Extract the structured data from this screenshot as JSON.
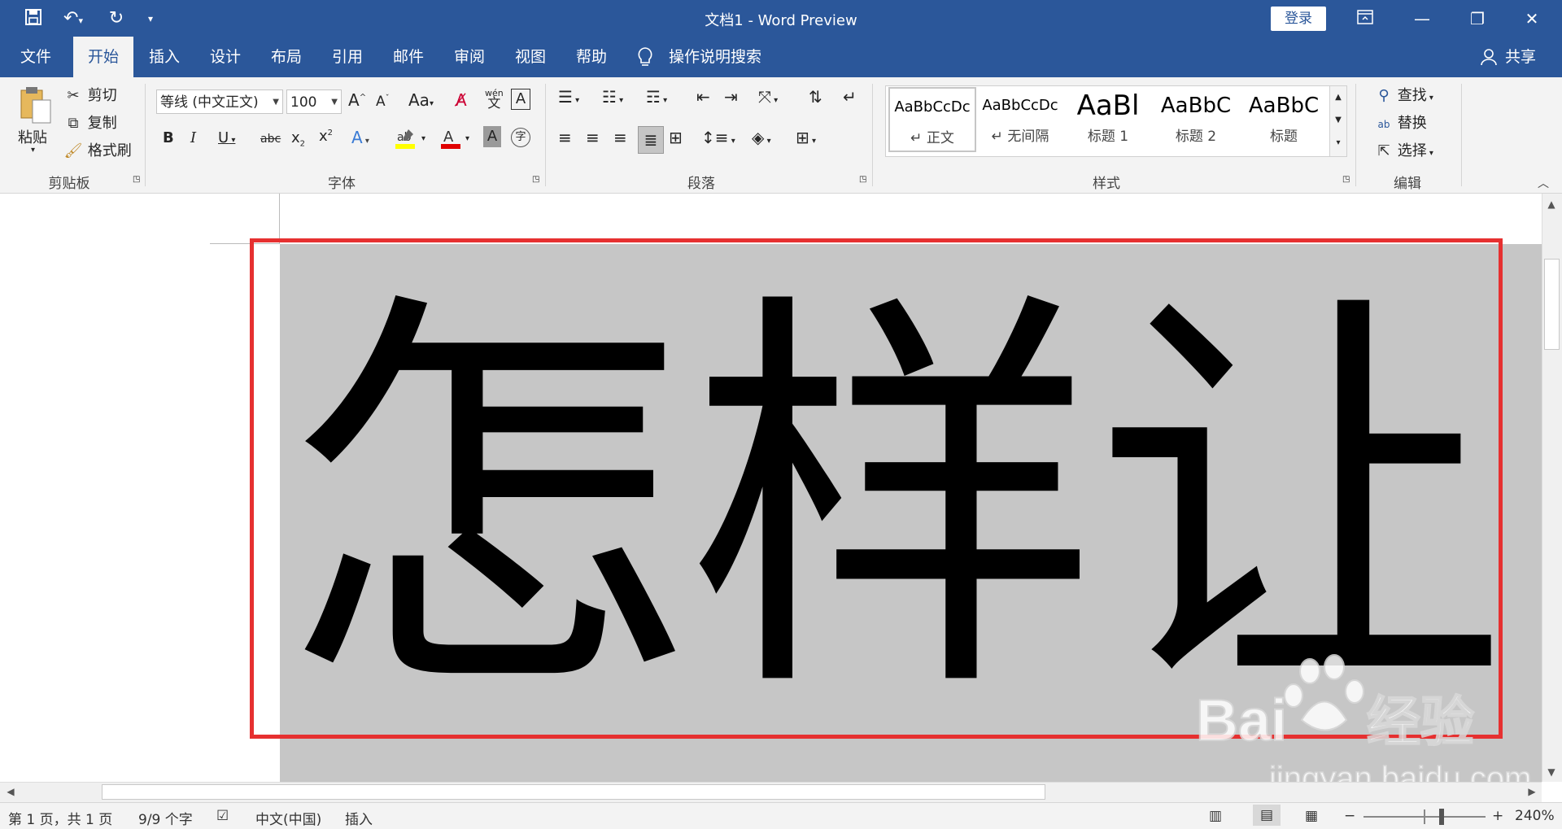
{
  "titlebar": {
    "doc_title": "文档1  -  Word Preview",
    "login": "登录",
    "icons": [
      "save-icon",
      "undo-icon",
      "redo-icon",
      "customize-qat-icon",
      "ribbon-display-icon",
      "restore-icon",
      "close-icon"
    ]
  },
  "tabs": [
    "文件",
    "开始",
    "插入",
    "设计",
    "布局",
    "引用",
    "邮件",
    "审阅",
    "视图",
    "帮助"
  ],
  "active_tab": "开始",
  "tell_me": "操作说明搜索",
  "share": "共享",
  "clipboard": {
    "paste": "粘贴",
    "cut": "剪切",
    "copy": "复制",
    "format_painter": "格式刷",
    "label": "剪贴板"
  },
  "font": {
    "name": "等线 (中文正文)",
    "size": "100",
    "label": "字体",
    "change_case": "Aa",
    "phonetic": "wén"
  },
  "paragraph": {
    "label": "段落"
  },
  "styles": {
    "label": "样式",
    "items": [
      {
        "preview": "AaBbCcDc",
        "name": "↵ 正文"
      },
      {
        "preview": "AaBbCcDc",
        "name": "↵ 无间隔"
      },
      {
        "preview": "AaBl",
        "name": "标题 1"
      },
      {
        "preview": "AaBbC",
        "name": "标题 2"
      },
      {
        "preview": "AaBbC",
        "name": "标题"
      }
    ]
  },
  "editing": {
    "find": "查找",
    "replace": "替换",
    "select": "选择",
    "label": "编辑"
  },
  "document": {
    "text": "怎样让"
  },
  "status": {
    "page": "第 1 页，共 1 页",
    "words": "9/9 个字",
    "language": "中文(中国)",
    "mode": "插入",
    "zoom": "240%"
  },
  "watermark": {
    "brand": "Bai",
    "brand2": "经验",
    "url": "jingyan.baidu.com"
  },
  "colors": {
    "accent": "#2b579a",
    "highlight": "#c6c6c6",
    "box": "#e63030",
    "font_color": "#e00000",
    "highlight_yellow": "#ffff00"
  }
}
